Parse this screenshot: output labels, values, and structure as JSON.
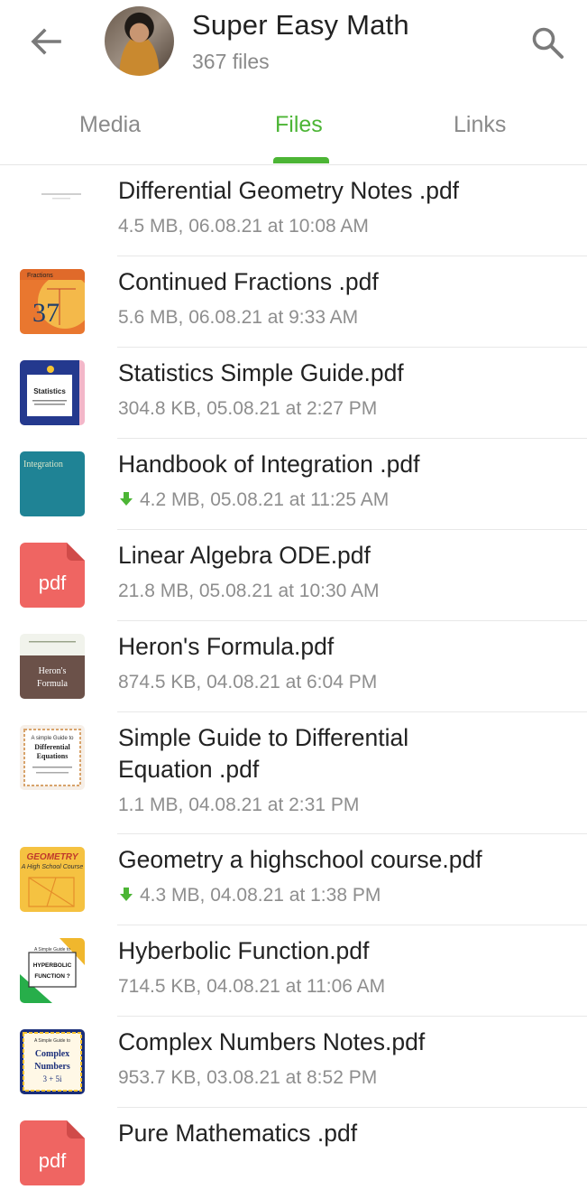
{
  "header": {
    "title": "Super Easy Math",
    "subtitle": "367 files",
    "back_icon": "arrow-left-icon",
    "search_icon": "search-icon",
    "accent_color": "#4cb535"
  },
  "tabs": [
    {
      "label": "Media",
      "active": false
    },
    {
      "label": "Files",
      "active": true
    },
    {
      "label": "Links",
      "active": false
    }
  ],
  "files": [
    {
      "name": "Differential Geometry Notes .pdf",
      "meta": "4.5 MB, 06.08.21 at 10:08 AM",
      "downloading": false
    },
    {
      "name": "Continued Fractions .pdf",
      "meta": "5.6 MB, 06.08.21 at 9:33 AM",
      "downloading": false,
      "thumb_text": "Fractions"
    },
    {
      "name": "Statistics Simple Guide.pdf",
      "meta": "304.8 KB, 05.08.21 at 2:27 PM",
      "downloading": false,
      "thumb_text": "Statistics"
    },
    {
      "name": "Handbook of Integration .pdf",
      "meta": "4.2 MB, 05.08.21 at 11:25 AM",
      "downloading": true,
      "thumb_text": "Integration"
    },
    {
      "name": "Linear Algebra ODE.pdf",
      "meta": "21.8 MB, 05.08.21 at 10:30 AM",
      "downloading": false,
      "icon_label": "pdf"
    },
    {
      "name": "Heron's Formula.pdf",
      "meta": "874.5 KB, 04.08.21 at 6:04 PM",
      "downloading": false,
      "thumb_text": "Heron's Formula"
    },
    {
      "name_line1": "Simple Guide to Differential",
      "name_line2": "Equation .pdf",
      "meta": "1.1 MB, 04.08.21 at 2:31 PM",
      "downloading": false,
      "thumb_text": "Differential Equations"
    },
    {
      "name": "Geometry a highschool course.pdf",
      "meta": "4.3 MB, 04.08.21 at 1:38 PM",
      "downloading": true,
      "thumb_text": "GEOMETRY"
    },
    {
      "name": "Hyberbolic Function.pdf",
      "meta": "714.5 KB, 04.08.21 at 11:06 AM",
      "downloading": false,
      "thumb_text": "HYPERBOLIC FUNCTION ?"
    },
    {
      "name": "Complex Numbers Notes.pdf",
      "meta": "953.7 KB, 03.08.21 at 8:52 PM",
      "downloading": false,
      "thumb_text": "Complex Numbers"
    },
    {
      "name": "Pure Mathematics .pdf",
      "meta": "",
      "downloading": false,
      "icon_label": "pdf"
    }
  ]
}
